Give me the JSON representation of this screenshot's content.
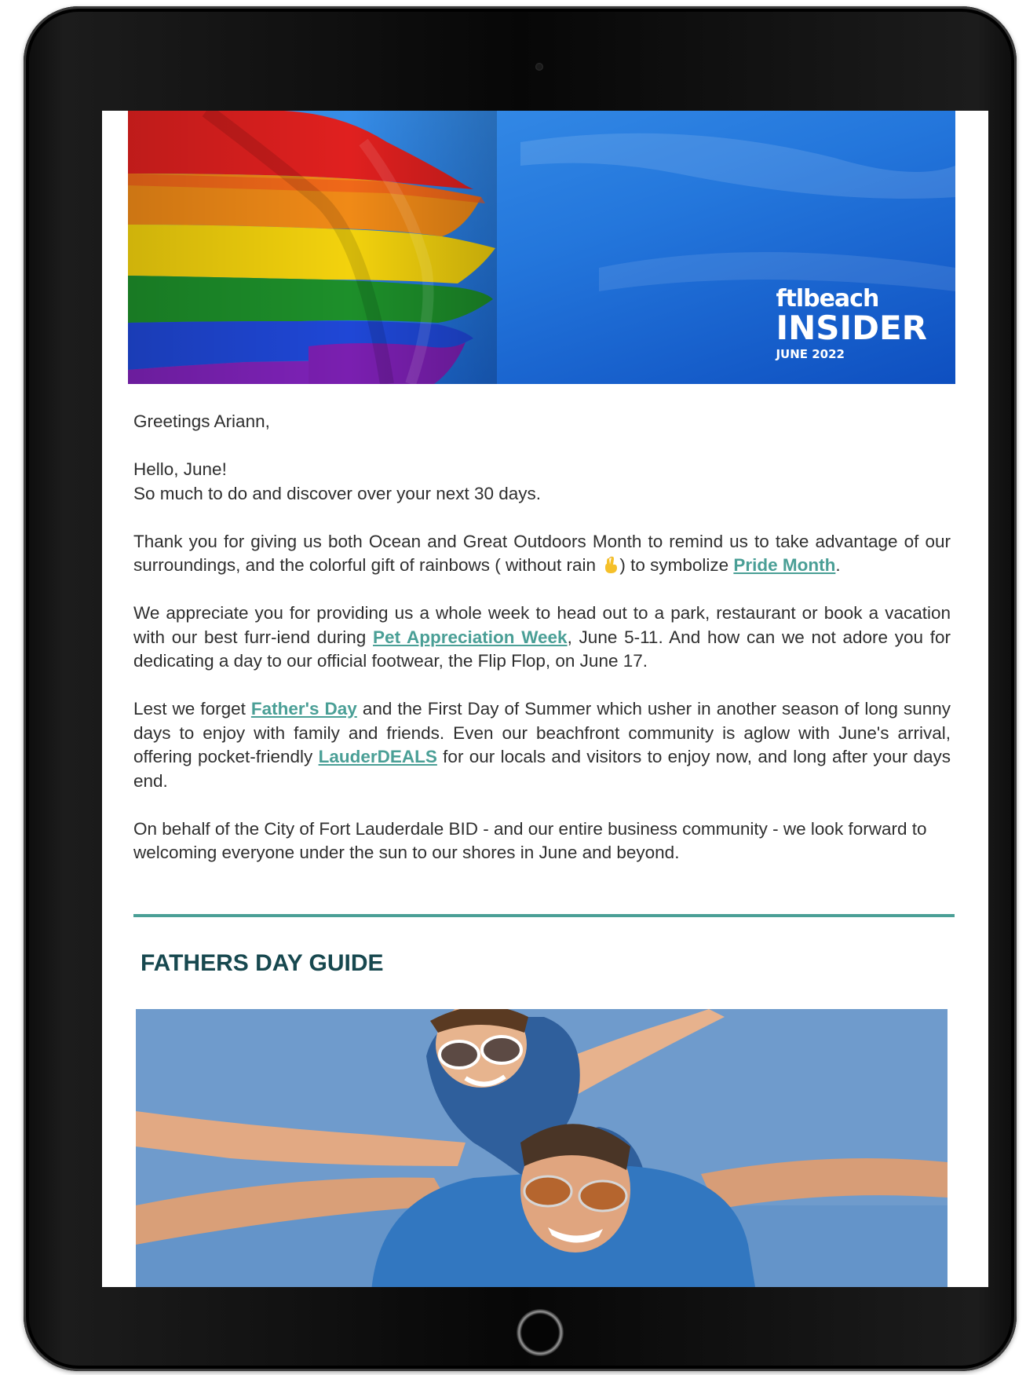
{
  "header": {
    "brand_top": "ftlbeach",
    "brand_main": "INSIDER",
    "brand_date": "JUNE 2022"
  },
  "email": {
    "greeting": "Greetings Ariann,",
    "intro_line1": "Hello, June!",
    "intro_line2": "So much to do and discover over your next 30 days.",
    "p1_text_before": "Thank you for giving us both Ocean and Great Outdoors Month to remind us to take advantage of our surroundings, and the colorful gift of rainbows ( without rain ",
    "p1_text_mid": ") to symbolize ",
    "p1_link": "Pride Month",
    "p1_text_end": ".",
    "p2_text_before": "We appreciate you for providing us a whole week to head out to a park, restaurant or book a vacation with our best furr-iend during ",
    "p2_link": "Pet Appreciation Week",
    "p2_text_after": ", June 5-11. And how can we not adore you for dedicating a day to our official footwear, the Flip Flop, on June 17.",
    "p3_text_before": "Lest we forget ",
    "p3_link": "Father's Day",
    "p3_text_mid": " and the First Day of Summer which usher in another season of long sunny days to enjoy with family and friends. Even our beachfront community is aglow with June's arrival, offering pocket-friendly ",
    "p3_link2": "LauderDEALS",
    "p3_text_after": " for our locals and visitors to enjoy now, and long after your days end.",
    "p4_text": "On behalf of the City of Fort Lauderdale BID - and our entire business community - we look forward to welcoming everyone under the sun to our shores in June and beyond."
  },
  "section": {
    "title": "FATHERS DAY GUIDE"
  },
  "colors": {
    "accent": "#4a9f96",
    "heading": "#17484f",
    "text": "#2f2f2f"
  },
  "icons": [
    "crossed-fingers-emoji"
  ]
}
